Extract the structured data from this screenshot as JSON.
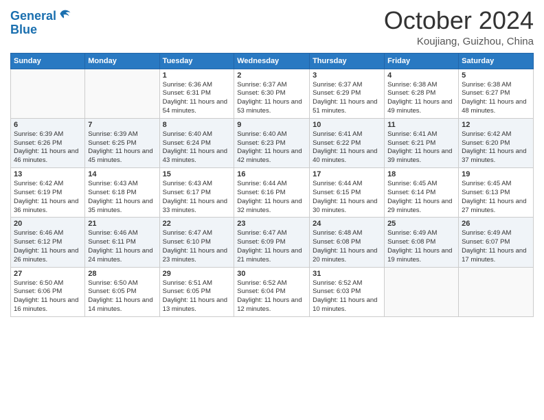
{
  "header": {
    "logo_line1": "General",
    "logo_line2": "Blue",
    "month": "October 2024",
    "location": "Koujiang, Guizhou, China"
  },
  "weekdays": [
    "Sunday",
    "Monday",
    "Tuesday",
    "Wednesday",
    "Thursday",
    "Friday",
    "Saturday"
  ],
  "weeks": [
    [
      {
        "day": "",
        "sunrise": "",
        "sunset": "",
        "daylight": ""
      },
      {
        "day": "",
        "sunrise": "",
        "sunset": "",
        "daylight": ""
      },
      {
        "day": "1",
        "sunrise": "Sunrise: 6:36 AM",
        "sunset": "Sunset: 6:31 PM",
        "daylight": "Daylight: 11 hours and 54 minutes."
      },
      {
        "day": "2",
        "sunrise": "Sunrise: 6:37 AM",
        "sunset": "Sunset: 6:30 PM",
        "daylight": "Daylight: 11 hours and 53 minutes."
      },
      {
        "day": "3",
        "sunrise": "Sunrise: 6:37 AM",
        "sunset": "Sunset: 6:29 PM",
        "daylight": "Daylight: 11 hours and 51 minutes."
      },
      {
        "day": "4",
        "sunrise": "Sunrise: 6:38 AM",
        "sunset": "Sunset: 6:28 PM",
        "daylight": "Daylight: 11 hours and 49 minutes."
      },
      {
        "day": "5",
        "sunrise": "Sunrise: 6:38 AM",
        "sunset": "Sunset: 6:27 PM",
        "daylight": "Daylight: 11 hours and 48 minutes."
      }
    ],
    [
      {
        "day": "6",
        "sunrise": "Sunrise: 6:39 AM",
        "sunset": "Sunset: 6:26 PM",
        "daylight": "Daylight: 11 hours and 46 minutes."
      },
      {
        "day": "7",
        "sunrise": "Sunrise: 6:39 AM",
        "sunset": "Sunset: 6:25 PM",
        "daylight": "Daylight: 11 hours and 45 minutes."
      },
      {
        "day": "8",
        "sunrise": "Sunrise: 6:40 AM",
        "sunset": "Sunset: 6:24 PM",
        "daylight": "Daylight: 11 hours and 43 minutes."
      },
      {
        "day": "9",
        "sunrise": "Sunrise: 6:40 AM",
        "sunset": "Sunset: 6:23 PM",
        "daylight": "Daylight: 11 hours and 42 minutes."
      },
      {
        "day": "10",
        "sunrise": "Sunrise: 6:41 AM",
        "sunset": "Sunset: 6:22 PM",
        "daylight": "Daylight: 11 hours and 40 minutes."
      },
      {
        "day": "11",
        "sunrise": "Sunrise: 6:41 AM",
        "sunset": "Sunset: 6:21 PM",
        "daylight": "Daylight: 11 hours and 39 minutes."
      },
      {
        "day": "12",
        "sunrise": "Sunrise: 6:42 AM",
        "sunset": "Sunset: 6:20 PM",
        "daylight": "Daylight: 11 hours and 37 minutes."
      }
    ],
    [
      {
        "day": "13",
        "sunrise": "Sunrise: 6:42 AM",
        "sunset": "Sunset: 6:19 PM",
        "daylight": "Daylight: 11 hours and 36 minutes."
      },
      {
        "day": "14",
        "sunrise": "Sunrise: 6:43 AM",
        "sunset": "Sunset: 6:18 PM",
        "daylight": "Daylight: 11 hours and 35 minutes."
      },
      {
        "day": "15",
        "sunrise": "Sunrise: 6:43 AM",
        "sunset": "Sunset: 6:17 PM",
        "daylight": "Daylight: 11 hours and 33 minutes."
      },
      {
        "day": "16",
        "sunrise": "Sunrise: 6:44 AM",
        "sunset": "Sunset: 6:16 PM",
        "daylight": "Daylight: 11 hours and 32 minutes."
      },
      {
        "day": "17",
        "sunrise": "Sunrise: 6:44 AM",
        "sunset": "Sunset: 6:15 PM",
        "daylight": "Daylight: 11 hours and 30 minutes."
      },
      {
        "day": "18",
        "sunrise": "Sunrise: 6:45 AM",
        "sunset": "Sunset: 6:14 PM",
        "daylight": "Daylight: 11 hours and 29 minutes."
      },
      {
        "day": "19",
        "sunrise": "Sunrise: 6:45 AM",
        "sunset": "Sunset: 6:13 PM",
        "daylight": "Daylight: 11 hours and 27 minutes."
      }
    ],
    [
      {
        "day": "20",
        "sunrise": "Sunrise: 6:46 AM",
        "sunset": "Sunset: 6:12 PM",
        "daylight": "Daylight: 11 hours and 26 minutes."
      },
      {
        "day": "21",
        "sunrise": "Sunrise: 6:46 AM",
        "sunset": "Sunset: 6:11 PM",
        "daylight": "Daylight: 11 hours and 24 minutes."
      },
      {
        "day": "22",
        "sunrise": "Sunrise: 6:47 AM",
        "sunset": "Sunset: 6:10 PM",
        "daylight": "Daylight: 11 hours and 23 minutes."
      },
      {
        "day": "23",
        "sunrise": "Sunrise: 6:47 AM",
        "sunset": "Sunset: 6:09 PM",
        "daylight": "Daylight: 11 hours and 21 minutes."
      },
      {
        "day": "24",
        "sunrise": "Sunrise: 6:48 AM",
        "sunset": "Sunset: 6:08 PM",
        "daylight": "Daylight: 11 hours and 20 minutes."
      },
      {
        "day": "25",
        "sunrise": "Sunrise: 6:49 AM",
        "sunset": "Sunset: 6:08 PM",
        "daylight": "Daylight: 11 hours and 19 minutes."
      },
      {
        "day": "26",
        "sunrise": "Sunrise: 6:49 AM",
        "sunset": "Sunset: 6:07 PM",
        "daylight": "Daylight: 11 hours and 17 minutes."
      }
    ],
    [
      {
        "day": "27",
        "sunrise": "Sunrise: 6:50 AM",
        "sunset": "Sunset: 6:06 PM",
        "daylight": "Daylight: 11 hours and 16 minutes."
      },
      {
        "day": "28",
        "sunrise": "Sunrise: 6:50 AM",
        "sunset": "Sunset: 6:05 PM",
        "daylight": "Daylight: 11 hours and 14 minutes."
      },
      {
        "day": "29",
        "sunrise": "Sunrise: 6:51 AM",
        "sunset": "Sunset: 6:05 PM",
        "daylight": "Daylight: 11 hours and 13 minutes."
      },
      {
        "day": "30",
        "sunrise": "Sunrise: 6:52 AM",
        "sunset": "Sunset: 6:04 PM",
        "daylight": "Daylight: 11 hours and 12 minutes."
      },
      {
        "day": "31",
        "sunrise": "Sunrise: 6:52 AM",
        "sunset": "Sunset: 6:03 PM",
        "daylight": "Daylight: 11 hours and 10 minutes."
      },
      {
        "day": "",
        "sunrise": "",
        "sunset": "",
        "daylight": ""
      },
      {
        "day": "",
        "sunrise": "",
        "sunset": "",
        "daylight": ""
      }
    ]
  ]
}
